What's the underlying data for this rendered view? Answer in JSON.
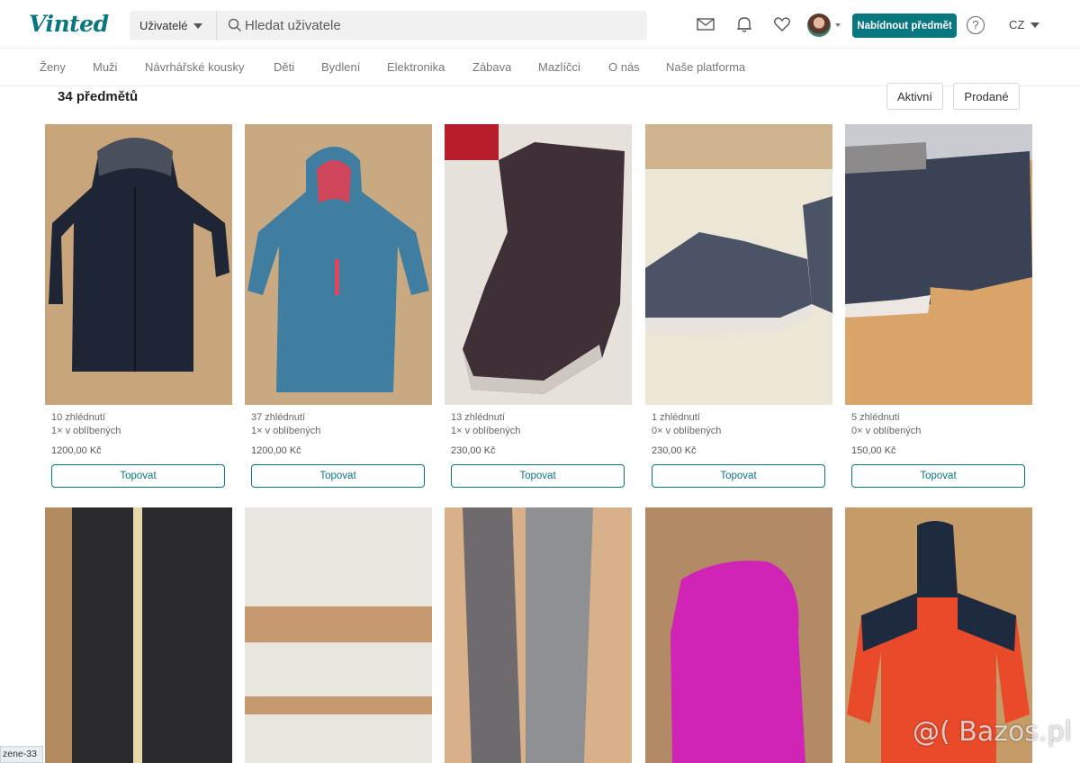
{
  "header": {
    "logo": "Vinted",
    "scope_select": "Uživatelé",
    "search_placeholder": "Hledat uživatele",
    "sell_button": "Nabídnout předmět",
    "language": "CZ"
  },
  "categories": [
    "Ženy",
    "Muži",
    "Návrhářské kousky",
    "Děti",
    "Bydlení",
    "Elektronika",
    "Zábava",
    "Mazlíčci",
    "O nás",
    "Naše platforma"
  ],
  "toolbar": {
    "item_count": "34 předmětů",
    "active_button": "Aktivní",
    "sold_button": "Prodané"
  },
  "items": [
    {
      "views": "10 zhlédnutí",
      "favorites": "1× v oblíbených",
      "price": "1200,00 Kč",
      "bump": "Topovat"
    },
    {
      "views": "37 zhlédnutí",
      "favorites": "1× v oblíbených",
      "price": "1200,00 Kč",
      "bump": "Topovat"
    },
    {
      "views": "13 zhlédnutí",
      "favorites": "1× v oblíbených",
      "price": "230,00 Kč",
      "bump": "Topovat"
    },
    {
      "views": "1 zhlédnutí",
      "favorites": "0× v oblíbených",
      "price": "230,00 Kč",
      "bump": "Topovat"
    },
    {
      "views": "5 zhlédnutí",
      "favorites": "0× v oblíbených",
      "price": "150,00 Kč",
      "bump": "Topovat"
    }
  ],
  "footer_tag": "zene-33",
  "watermark": "@( Bazos.pl",
  "colors": {
    "brand": "#09777f"
  }
}
